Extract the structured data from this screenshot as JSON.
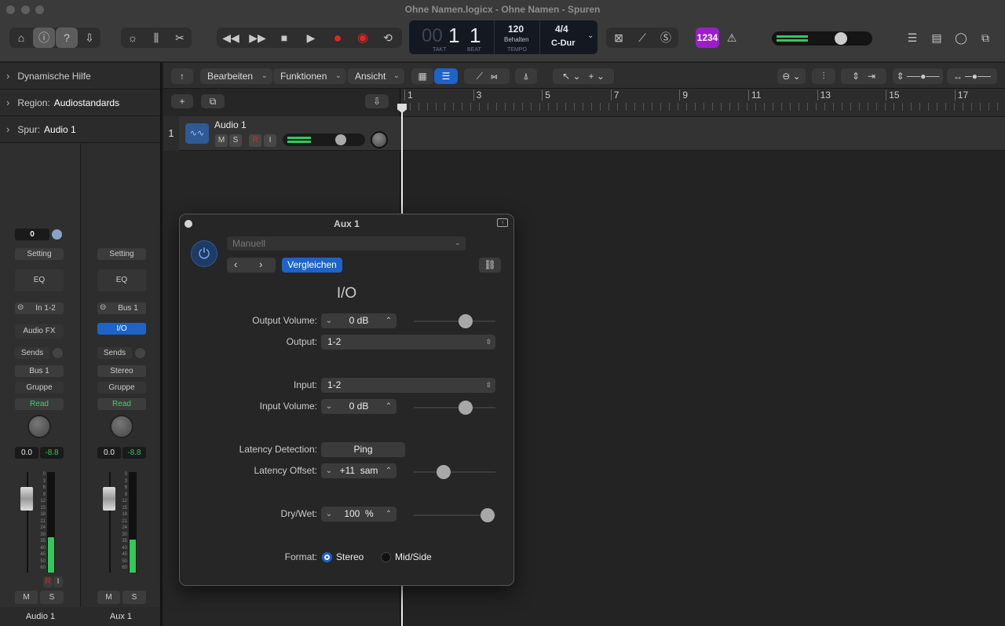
{
  "window": {
    "title": "Ohne Namen.logicx - Ohne Namen - Spuren"
  },
  "lcd": {
    "bar_dim": "00",
    "bar": "1",
    "beat": "1",
    "bar_label": "TAKT",
    "beat_label": "BEAT",
    "tempo": "120",
    "tempo_mode": "Behalten",
    "tempo_label": "TEMPO",
    "signature": "4/4",
    "key": "C-Dur"
  },
  "toolbar": {
    "count_in": "1234"
  },
  "inspector": {
    "rows": [
      {
        "label": "Dynamische Hilfe",
        "value": ""
      },
      {
        "label": "Region:",
        "value": "Audiostandards"
      },
      {
        "label": "Spur:",
        "value": "Audio 1"
      }
    ]
  },
  "strips": [
    {
      "gain": "0",
      "setting": "Setting",
      "eq": "EQ",
      "input": "In 1-2",
      "fx": "Audio FX",
      "sends": "Sends",
      "output": "Bus 1",
      "group": "Gruppe",
      "automation": "Read",
      "volume": "0.0",
      "peak": "-8.8",
      "mute": "M",
      "solo": "S",
      "record": "R",
      "input_monitor": "I",
      "name": "Audio 1",
      "meter_level": 0.35
    },
    {
      "setting": "Setting",
      "eq": "EQ",
      "input": "Bus 1",
      "fx": "I/O",
      "sends": "Sends",
      "output": "Stereo",
      "group": "Gruppe",
      "automation": "Read",
      "volume": "0.0",
      "peak": "-8.8",
      "mute": "M",
      "solo": "S",
      "name": "Aux 1",
      "meter_level": 0.33
    }
  ],
  "meter_scale": [
    "0",
    "3",
    "6",
    "9",
    "12",
    "15",
    "18",
    "21",
    "24",
    "30",
    "35",
    "40",
    "45",
    "50",
    "60"
  ],
  "menus": {
    "edit": "Bearbeiten",
    "functions": "Funktionen",
    "view": "Ansicht"
  },
  "ruler": {
    "bars": [
      "1",
      "3",
      "5",
      "7",
      "9",
      "11",
      "13",
      "15",
      "17"
    ]
  },
  "track": {
    "number": "1",
    "name": "Audio 1",
    "mute": "M",
    "solo": "S",
    "record": "R",
    "input_monitor": "I"
  },
  "plugin": {
    "title": "Aux 1",
    "preset": "Manuell",
    "compare": "Vergleichen",
    "name": "I/O",
    "output_volume_label": "Output Volume:",
    "output_volume": "0 dB",
    "output_label": "Output:",
    "output": "1-2",
    "input_label": "Input:",
    "input": "1-2",
    "input_volume_label": "Input Volume:",
    "input_volume": "0 dB",
    "latency_detection_label": "Latency Detection:",
    "ping": "Ping",
    "latency_offset_label": "Latency Offset:",
    "latency_offset": "+11  sam",
    "drywet_label": "Dry/Wet:",
    "drywet": "100  %",
    "format_label": "Format:",
    "format_stereo": "Stereo",
    "format_midside": "Mid/Side"
  },
  "colors": {
    "accent": "#1d63c8",
    "record": "#e0261f",
    "meter": "#2fca5a",
    "count_in": "#9a1fc9"
  }
}
